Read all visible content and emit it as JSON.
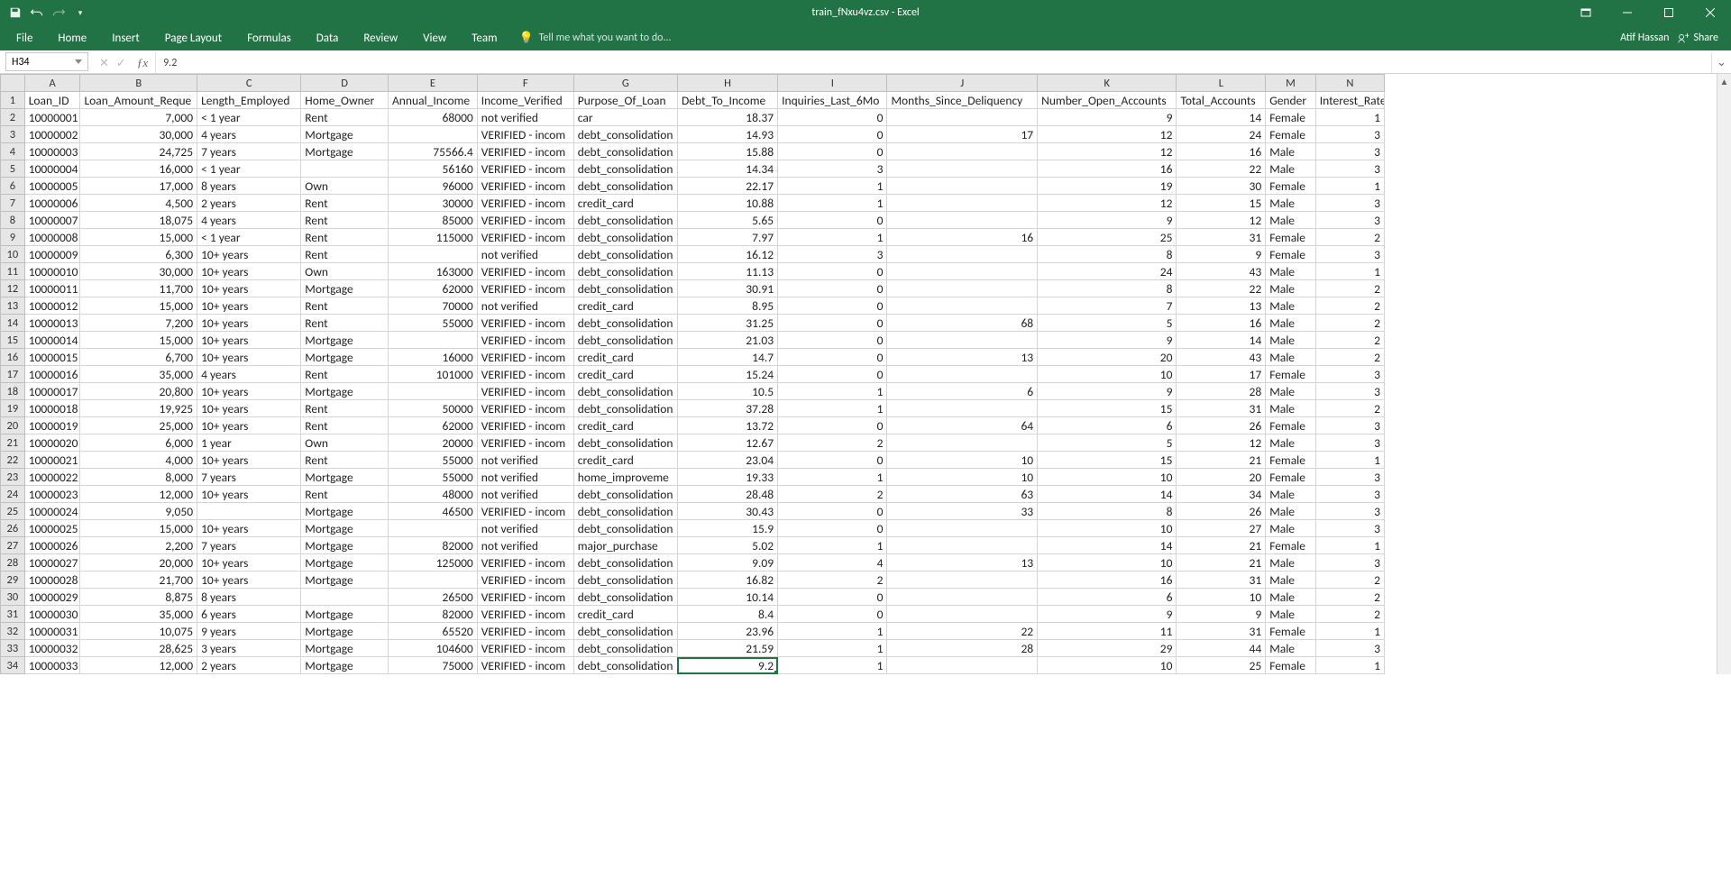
{
  "title": "train_fNxu4vz.csv - Excel",
  "user": "Atif Hassan",
  "share_label": "Share",
  "ribbon_tabs": [
    "File",
    "Home",
    "Insert",
    "Page Layout",
    "Formulas",
    "Data",
    "Review",
    "View",
    "Team"
  ],
  "tellme_placeholder": "Tell me what you want to do...",
  "name_box": "H34",
  "formula_value": "9.2",
  "columns": [
    "A",
    "B",
    "C",
    "D",
    "E",
    "F",
    "G",
    "H",
    "I",
    "J",
    "K",
    "L",
    "M",
    "N"
  ],
  "headers": [
    "Loan_ID",
    "Loan_Amount_Requested",
    "Length_Employed",
    "Home_Owner",
    "Annual_Income",
    "Income_Verified",
    "Purpose_Of_Loan",
    "Debt_To_Income",
    "Inquiries_Last_6Mo",
    "Months_Since_Deliquency",
    "Number_Open_Accounts",
    "Total_Accounts",
    "Gender",
    "Interest_Rate"
  ],
  "selected": {
    "row": 34,
    "col": "H"
  },
  "chart_data": {
    "type": "table",
    "columns": [
      "Loan_ID",
      "Loan_Amount_Requested",
      "Length_Employed",
      "Home_Owner",
      "Annual_Income",
      "Income_Verified",
      "Purpose_Of_Loan",
      "Debt_To_Income",
      "Inquiries_Last_6Mo",
      "Months_Since_Deliquency",
      "Number_Open_Accounts",
      "Total_Accounts",
      "Gender",
      "Interest_Rate"
    ],
    "rows": [
      [
        "10000001",
        "7,000",
        "< 1 year",
        "Rent",
        "68000",
        "not verified",
        "car",
        "18.37",
        "0",
        "",
        "9",
        "14",
        "Female",
        "1"
      ],
      [
        "10000002",
        "30,000",
        "4 years",
        "Mortgage",
        "",
        "VERIFIED - income",
        "debt_consolidation",
        "14.93",
        "0",
        "17",
        "12",
        "24",
        "Female",
        "3"
      ],
      [
        "10000003",
        "24,725",
        "7 years",
        "Mortgage",
        "75566.4",
        "VERIFIED - income",
        "debt_consolidation",
        "15.88",
        "0",
        "",
        "12",
        "16",
        "Male",
        "3"
      ],
      [
        "10000004",
        "16,000",
        "< 1 year",
        "",
        "56160",
        "VERIFIED - income",
        "debt_consolidation",
        "14.34",
        "3",
        "",
        "16",
        "22",
        "Male",
        "3"
      ],
      [
        "10000005",
        "17,000",
        "8 years",
        "Own",
        "96000",
        "VERIFIED - income",
        "debt_consolidation",
        "22.17",
        "1",
        "",
        "19",
        "30",
        "Female",
        "1"
      ],
      [
        "10000006",
        "4,500",
        "2 years",
        "Rent",
        "30000",
        "VERIFIED - income",
        "credit_card",
        "10.88",
        "1",
        "",
        "12",
        "15",
        "Male",
        "3"
      ],
      [
        "10000007",
        "18,075",
        "4 years",
        "Rent",
        "85000",
        "VERIFIED - income",
        "debt_consolidation",
        "5.65",
        "0",
        "",
        "9",
        "12",
        "Male",
        "3"
      ],
      [
        "10000008",
        "15,000",
        "< 1 year",
        "Rent",
        "115000",
        "VERIFIED - income",
        "debt_consolidation",
        "7.97",
        "1",
        "16",
        "25",
        "31",
        "Female",
        "2"
      ],
      [
        "10000009",
        "6,300",
        "10+ years",
        "Rent",
        "",
        "not verified",
        "debt_consolidation",
        "16.12",
        "3",
        "",
        "8",
        "9",
        "Female",
        "3"
      ],
      [
        "10000010",
        "30,000",
        "10+ years",
        "Own",
        "163000",
        "VERIFIED - income",
        "debt_consolidation",
        "11.13",
        "0",
        "",
        "24",
        "43",
        "Male",
        "1"
      ],
      [
        "10000011",
        "11,700",
        "10+ years",
        "Mortgage",
        "62000",
        "VERIFIED - income",
        "debt_consolidation",
        "30.91",
        "0",
        "",
        "8",
        "22",
        "Male",
        "2"
      ],
      [
        "10000012",
        "15,000",
        "10+ years",
        "Rent",
        "70000",
        "not verified",
        "credit_card",
        "8.95",
        "0",
        "",
        "7",
        "13",
        "Male",
        "2"
      ],
      [
        "10000013",
        "7,200",
        "10+ years",
        "Rent",
        "55000",
        "VERIFIED - income",
        "debt_consolidation",
        "31.25",
        "0",
        "68",
        "5",
        "16",
        "Male",
        "2"
      ],
      [
        "10000014",
        "15,000",
        "10+ years",
        "Mortgage",
        "",
        "VERIFIED - income",
        "debt_consolidation",
        "21.03",
        "0",
        "",
        "9",
        "14",
        "Male",
        "2"
      ],
      [
        "10000015",
        "6,700",
        "10+ years",
        "Mortgage",
        "16000",
        "VERIFIED - income",
        "credit_card",
        "14.7",
        "0",
        "13",
        "20",
        "43",
        "Male",
        "2"
      ],
      [
        "10000016",
        "35,000",
        "4 years",
        "Rent",
        "101000",
        "VERIFIED - income",
        "credit_card",
        "15.24",
        "0",
        "",
        "10",
        "17",
        "Female",
        "3"
      ],
      [
        "10000017",
        "20,800",
        "10+ years",
        "Mortgage",
        "",
        "VERIFIED - income",
        "debt_consolidation",
        "10.5",
        "1",
        "6",
        "9",
        "28",
        "Male",
        "3"
      ],
      [
        "10000018",
        "19,925",
        "10+ years",
        "Rent",
        "50000",
        "VERIFIED - income",
        "debt_consolidation",
        "37.28",
        "1",
        "",
        "15",
        "31",
        "Male",
        "2"
      ],
      [
        "10000019",
        "25,000",
        "10+ years",
        "Rent",
        "62000",
        "VERIFIED - income",
        "credit_card",
        "13.72",
        "0",
        "64",
        "6",
        "26",
        "Female",
        "3"
      ],
      [
        "10000020",
        "6,000",
        "1 year",
        "Own",
        "20000",
        "VERIFIED - income",
        "debt_consolidation",
        "12.67",
        "2",
        "",
        "5",
        "12",
        "Male",
        "3"
      ],
      [
        "10000021",
        "4,000",
        "10+ years",
        "Rent",
        "55000",
        "not verified",
        "credit_card",
        "23.04",
        "0",
        "10",
        "15",
        "21",
        "Female",
        "1"
      ],
      [
        "10000022",
        "8,000",
        "7 years",
        "Mortgage",
        "55000",
        "not verified",
        "home_improvement",
        "19.33",
        "1",
        "10",
        "10",
        "20",
        "Female",
        "3"
      ],
      [
        "10000023",
        "12,000",
        "10+ years",
        "Rent",
        "48000",
        "not verified",
        "debt_consolidation",
        "28.48",
        "2",
        "63",
        "14",
        "34",
        "Male",
        "3"
      ],
      [
        "10000024",
        "9,050",
        "",
        "Mortgage",
        "46500",
        "VERIFIED - income",
        "debt_consolidation",
        "30.43",
        "0",
        "33",
        "8",
        "26",
        "Male",
        "3"
      ],
      [
        "10000025",
        "15,000",
        "10+ years",
        "Mortgage",
        "",
        "not verified",
        "debt_consolidation",
        "15.9",
        "0",
        "",
        "10",
        "27",
        "Male",
        "3"
      ],
      [
        "10000026",
        "2,200",
        "7 years",
        "Mortgage",
        "82000",
        "not verified",
        "major_purchase",
        "5.02",
        "1",
        "",
        "14",
        "21",
        "Female",
        "1"
      ],
      [
        "10000027",
        "20,000",
        "10+ years",
        "Mortgage",
        "125000",
        "VERIFIED - income",
        "debt_consolidation",
        "9.09",
        "4",
        "13",
        "10",
        "21",
        "Male",
        "3"
      ],
      [
        "10000028",
        "21,700",
        "10+ years",
        "Mortgage",
        "",
        "VERIFIED - income",
        "debt_consolidation",
        "16.82",
        "2",
        "",
        "16",
        "31",
        "Male",
        "2"
      ],
      [
        "10000029",
        "8,875",
        "8 years",
        "",
        "26500",
        "VERIFIED - income",
        "debt_consolidation",
        "10.14",
        "0",
        "",
        "6",
        "10",
        "Male",
        "2"
      ],
      [
        "10000030",
        "35,000",
        "6 years",
        "Mortgage",
        "82000",
        "VERIFIED - income",
        "credit_card",
        "8.4",
        "0",
        "",
        "9",
        "9",
        "Male",
        "2"
      ],
      [
        "10000031",
        "10,075",
        "9 years",
        "Mortgage",
        "65520",
        "VERIFIED - income",
        "debt_consolidation",
        "23.96",
        "1",
        "22",
        "11",
        "31",
        "Female",
        "1"
      ],
      [
        "10000032",
        "28,625",
        "3 years",
        "Mortgage",
        "104600",
        "VERIFIED - income",
        "debt_consolidation",
        "21.59",
        "1",
        "28",
        "29",
        "44",
        "Male",
        "3"
      ],
      [
        "10000033",
        "12,000",
        "2 years",
        "Mortgage",
        "75000",
        "VERIFIED - income",
        "debt_consolidation",
        "9.2",
        "1",
        "",
        "10",
        "25",
        "Female",
        "1"
      ]
    ]
  },
  "numeric_cols": [
    1,
    4,
    7,
    8,
    9,
    10,
    11,
    13
  ],
  "truncated": {
    "1": "Loan_Amount_Reque",
    "5": "VERIFIED - incom",
    "6_debt": "debt_consolidation",
    "6_home": "home_improveme"
  }
}
